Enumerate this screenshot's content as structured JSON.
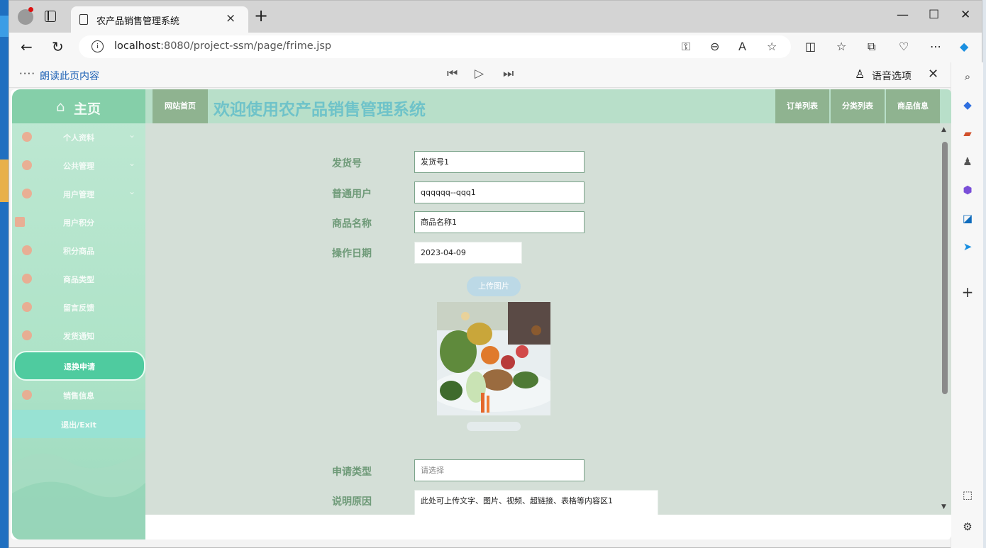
{
  "browser": {
    "tab_title": "农产品销售管理系统",
    "tab_close": "×",
    "new_tab": "+",
    "url_host": "localhost",
    "url_rest": ":8080/project-ssm/page/frime.jsp",
    "read_aloud_label": "朗读此页内容",
    "voice_options_label": "语音选项",
    "window_controls": [
      "—",
      "☐",
      "✕"
    ]
  },
  "sidebar": {
    "home_label": "主页",
    "items": [
      {
        "label": "个人资料",
        "has_chevron": true
      },
      {
        "label": "公共管理",
        "has_chevron": true
      },
      {
        "label": "用户管理",
        "has_chevron": true
      },
      {
        "label": "用户积分",
        "has_chevron": false
      },
      {
        "label": "积分商品",
        "has_chevron": false
      },
      {
        "label": "商品类型",
        "has_chevron": false
      },
      {
        "label": "留言反馈",
        "has_chevron": false
      },
      {
        "label": "发货通知",
        "has_chevron": false
      }
    ],
    "active_item": "退换申请",
    "after_active": "销售信息",
    "exit_label": "退出/Exit"
  },
  "topbar": {
    "site_home": "网站首页",
    "welcome_title": "欢迎使用农产品销售管理系统",
    "buttons": [
      "订单列表",
      "分类列表",
      "商品信息"
    ]
  },
  "form": {
    "shipment_no_label": "发货号",
    "shipment_no_value": "发货号1",
    "user_label": "普通用户",
    "user_value": "qqqqqq--qqq1",
    "product_label": "商品名称",
    "product_value": "商品名称1",
    "date_label": "操作日期",
    "date_value": "2023-04-09",
    "upload_label": "上传图片",
    "apply_type_label": "申请类型",
    "apply_type_placeholder": "请选择",
    "reason_label": "说明原因",
    "reason_value": "此处可上传文字、图片、视频、超链接、表格等内容区1"
  },
  "colors": {
    "sidebar_active": "#4fcb9f",
    "topbar_button": "#8fb390",
    "title_color": "#6fc3c9",
    "content_bg": "#d4dfd7"
  }
}
